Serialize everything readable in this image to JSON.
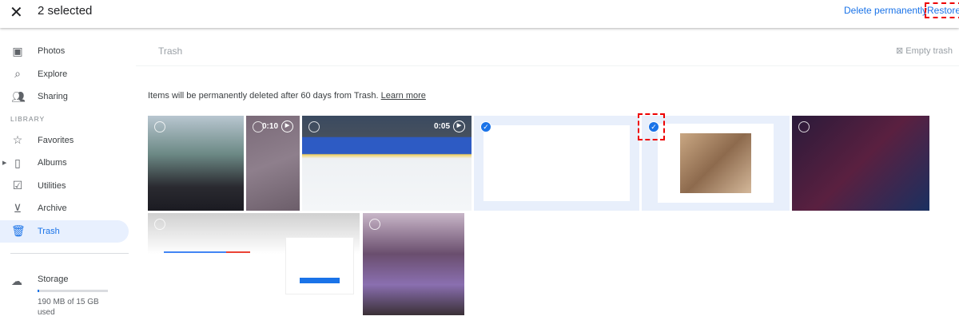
{
  "header": {
    "selected_count": "2 selected",
    "delete_label": "Delete permanently",
    "restore_label": "Restore"
  },
  "sidebar": {
    "items": [
      {
        "label": "Photos",
        "icon": "photo-icon"
      },
      {
        "label": "Explore",
        "icon": "search-icon"
      },
      {
        "label": "Sharing",
        "icon": "people-icon"
      }
    ],
    "library_header": "LIBRARY",
    "library_items": [
      {
        "label": "Favorites",
        "icon": "star-icon"
      },
      {
        "label": "Albums",
        "icon": "album-icon"
      },
      {
        "label": "Utilities",
        "icon": "utilities-icon"
      },
      {
        "label": "Archive",
        "icon": "archive-icon"
      },
      {
        "label": "Trash",
        "icon": "trash-icon"
      }
    ],
    "storage": {
      "label": "Storage",
      "usage": "190 MB of 15 GB used",
      "fraction": 0.013
    }
  },
  "main": {
    "title": "Trash",
    "empty_trash": "Empty trash",
    "notice": "Items will be permanently deleted after 60 days from Trash.",
    "learn_more": "Learn more",
    "videos": {
      "v1": "0:10",
      "v2": "0:05"
    }
  },
  "colors": {
    "accent": "#1a73e8",
    "highlight": "#e00000"
  }
}
